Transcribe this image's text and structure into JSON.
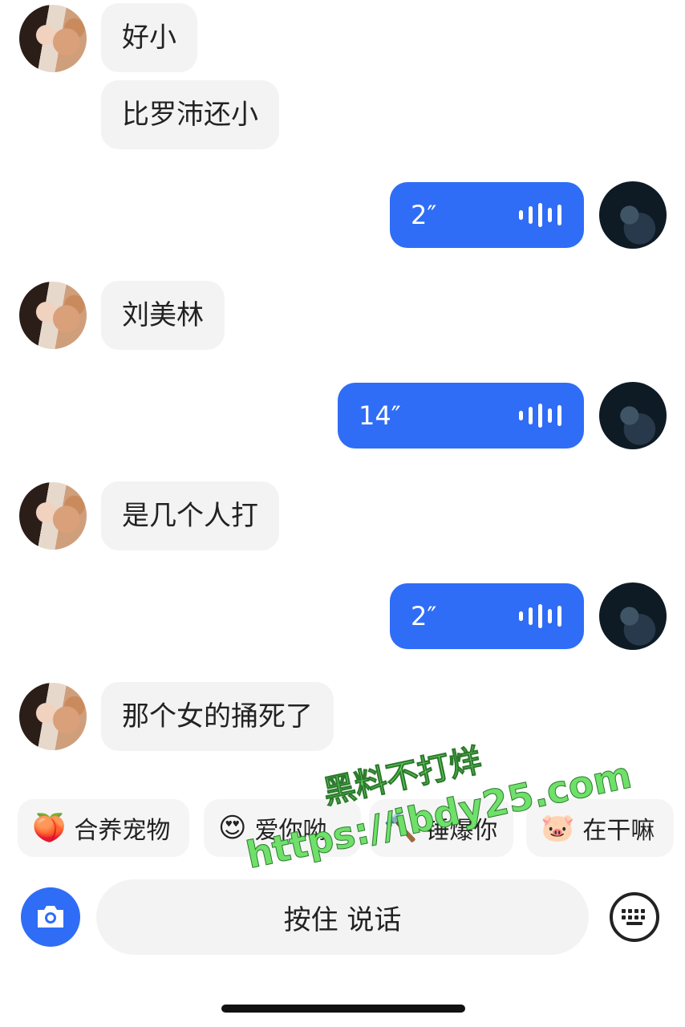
{
  "messages": [
    {
      "side": "in",
      "text": "好小"
    },
    {
      "side": "in",
      "text": "比罗沛还小"
    },
    {
      "side": "out",
      "voice": "2″"
    },
    {
      "side": "in",
      "text": "刘美林"
    },
    {
      "side": "out",
      "voice": "14″"
    },
    {
      "side": "in",
      "text": "是几个人打"
    },
    {
      "side": "out",
      "voice": "2″"
    },
    {
      "side": "in",
      "text": "那个女的捅死了"
    }
  ],
  "quick_replies": [
    {
      "label": "合养宠物",
      "icon": "peach-emoji-icon"
    },
    {
      "label": "爱你呦",
      "icon": "heart-eyes-emoji-icon"
    },
    {
      "label": "锤爆你",
      "icon": "hammer-emoji-icon"
    },
    {
      "label": "在干嘛",
      "icon": "cute-face-emoji-icon"
    }
  ],
  "input_bar": {
    "talk_label": "按住 说话"
  },
  "watermark": {
    "line1": "黑料不打烊",
    "line2": "https://ibdy25.com"
  },
  "colors": {
    "accent": "#2f6df6",
    "incoming_bubble": "#f3f3f3",
    "watermark": "#6fe06a"
  }
}
